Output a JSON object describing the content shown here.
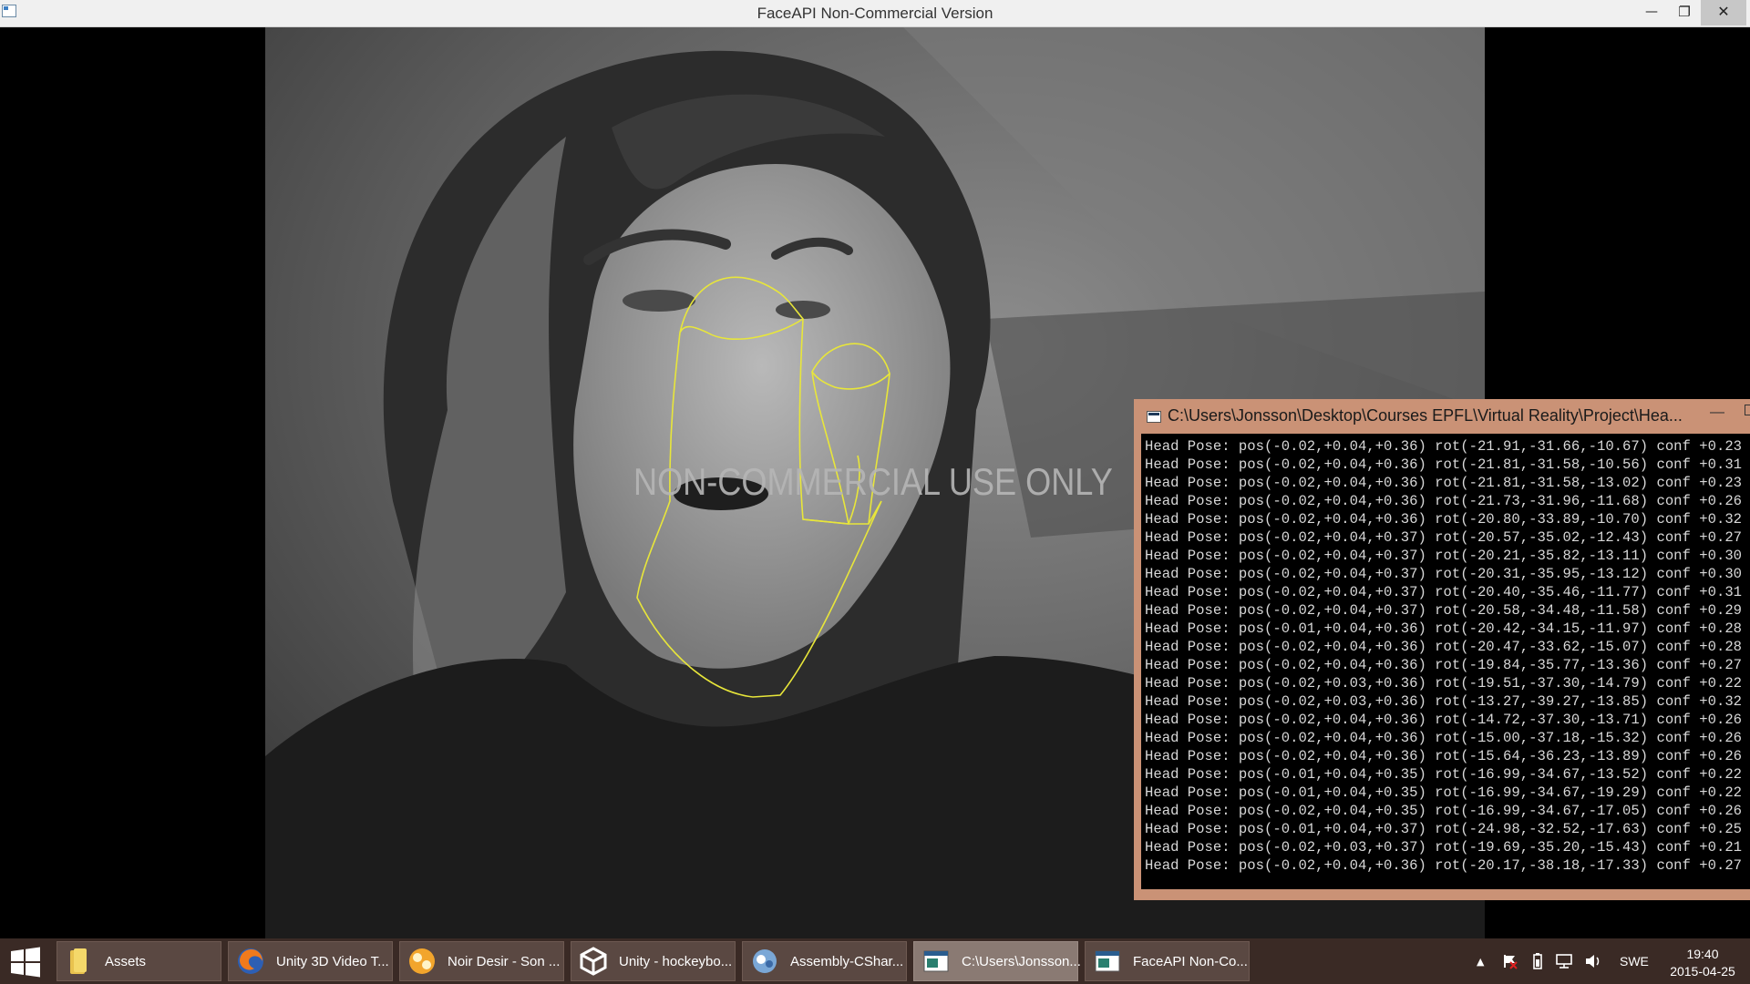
{
  "window": {
    "title": "FaceAPI Non-Commercial Version",
    "minimize_glyph": "—",
    "maximize_glyph": "❐",
    "close_glyph": "✕"
  },
  "camera": {
    "watermark": "NON-COMMERCIAL USE ONLY",
    "overlay_color": "#e8e63a"
  },
  "console": {
    "title": "C:\\Users\\Jonsson\\Desktop\\Courses EPFL\\Virtual Reality\\Project\\Hea...",
    "minimize_glyph": "—",
    "lines": [
      "Head Pose: pos(-0.02,+0.04,+0.36) rot(-21.91,-31.66,-10.67) conf +0.23",
      "Head Pose: pos(-0.02,+0.04,+0.36) rot(-21.81,-31.58,-10.56) conf +0.31",
      "Head Pose: pos(-0.02,+0.04,+0.36) rot(-21.81,-31.58,-13.02) conf +0.23",
      "Head Pose: pos(-0.02,+0.04,+0.36) rot(-21.73,-31.96,-11.68) conf +0.26",
      "Head Pose: pos(-0.02,+0.04,+0.36) rot(-20.80,-33.89,-10.70) conf +0.32",
      "Head Pose: pos(-0.02,+0.04,+0.37) rot(-20.57,-35.02,-12.43) conf +0.27",
      "Head Pose: pos(-0.02,+0.04,+0.37) rot(-20.21,-35.82,-13.11) conf +0.30",
      "Head Pose: pos(-0.02,+0.04,+0.37) rot(-20.31,-35.95,-13.12) conf +0.30",
      "Head Pose: pos(-0.02,+0.04,+0.37) rot(-20.40,-35.46,-11.77) conf +0.31",
      "Head Pose: pos(-0.02,+0.04,+0.37) rot(-20.58,-34.48,-11.58) conf +0.29",
      "Head Pose: pos(-0.01,+0.04,+0.36) rot(-20.42,-34.15,-11.97) conf +0.28",
      "Head Pose: pos(-0.02,+0.04,+0.36) rot(-20.47,-33.62,-15.07) conf +0.28",
      "Head Pose: pos(-0.02,+0.04,+0.36) rot(-19.84,-35.77,-13.36) conf +0.27",
      "Head Pose: pos(-0.02,+0.03,+0.36) rot(-19.51,-37.30,-14.79) conf +0.22",
      "Head Pose: pos(-0.02,+0.03,+0.36) rot(-13.27,-39.27,-13.85) conf +0.32",
      "Head Pose: pos(-0.02,+0.04,+0.36) rot(-14.72,-37.30,-13.71) conf +0.26",
      "Head Pose: pos(-0.02,+0.04,+0.36) rot(-15.00,-37.18,-15.32) conf +0.26",
      "Head Pose: pos(-0.02,+0.04,+0.36) rot(-15.64,-36.23,-13.89) conf +0.26",
      "Head Pose: pos(-0.01,+0.04,+0.35) rot(-16.99,-34.67,-13.52) conf +0.22",
      "Head Pose: pos(-0.01,+0.04,+0.35) rot(-16.99,-34.67,-19.29) conf +0.22",
      "Head Pose: pos(-0.02,+0.04,+0.35) rot(-16.99,-34.67,-17.05) conf +0.26",
      "Head Pose: pos(-0.01,+0.04,+0.37) rot(-24.98,-32.52,-17.63) conf +0.25",
      "Head Pose: pos(-0.02,+0.03,+0.37) rot(-19.69,-35.20,-15.43) conf +0.21",
      "Head Pose: pos(-0.02,+0.04,+0.36) rot(-20.17,-38.18,-17.33) conf +0.27"
    ]
  },
  "taskbar": {
    "start_icon": "windows-logo-icon",
    "buttons": [
      {
        "label": "Assets",
        "icon": "folder-icon"
      },
      {
        "label": "Unity 3D Video T...",
        "icon": "firefox-icon"
      },
      {
        "label": "Noir Desir - Son ...",
        "icon": "vlc-music-icon"
      },
      {
        "label": "Unity - hockeybo...",
        "icon": "unity-icon"
      },
      {
        "label": "Assembly-CShar...",
        "icon": "monodevelop-icon"
      },
      {
        "label": "C:\\Users\\Jonsson...",
        "icon": "console-window-icon"
      },
      {
        "label": "FaceAPI Non-Co...",
        "icon": "faceapi-window-icon"
      }
    ],
    "tray": {
      "overflow_glyph": "▲",
      "language": "SWE",
      "time": "19:40",
      "date": "2015-04-25"
    }
  }
}
